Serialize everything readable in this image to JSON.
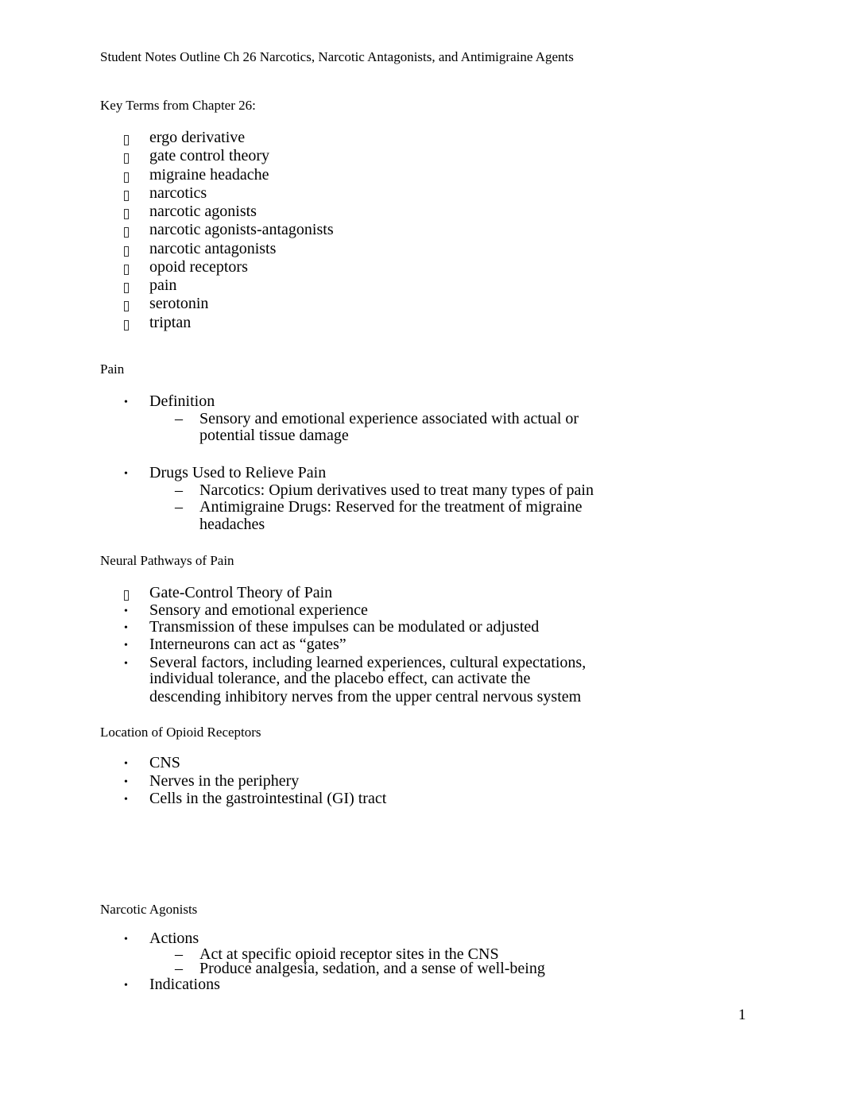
{
  "document": {
    "title": "Student Notes Outline Ch 26 Narcotics, Narcotic Antagonists, and Antimigraine Agents",
    "page_number": "1",
    "key_terms": {
      "heading": "Key Terms from Chapter 26:",
      "bullet_icon": "missing-glyph-box",
      "items": [
        "ergo derivative",
        "gate control theory",
        "migraine headache",
        "narcotics",
        "narcotic agonists",
        "narcotic agonists-antagonists",
        "narcotic antagonists",
        "opoid receptors",
        "pain",
        "serotonin",
        "triptan"
      ]
    },
    "pain": {
      "heading": "Pain",
      "definition": {
        "label": "Definition",
        "sub": [
          "Sensory and emotional experience associated with actual or",
          "potential tissue damage"
        ]
      },
      "drugs": {
        "label": "Drugs Used to Relieve Pain",
        "sub1": "Narcotics: Opium derivatives used to treat many types of pain",
        "sub2": [
          "Antimigraine Drugs: Reserved for the treatment of migraine",
          "headaches"
        ]
      }
    },
    "neural": {
      "heading": "Neural Pathways of Pain",
      "items": [
        "Gate-Control Theory of Pain",
        "Sensory and emotional experience",
        "Transmission of these impulses can be modulated or adjusted",
        "Interneurons can act as “gates”"
      ],
      "last": [
        "Several factors, including learned experiences, cultural expectations,",
        "individual tolerance, and the placebo effect, can activate the",
        "descending inhibitory nerves from the upper central nervous system"
      ]
    },
    "opioid": {
      "heading": "Location of Opioid Receptors",
      "items": [
        "CNS",
        "Nerves in the periphery",
        "Cells in the gastrointestinal (GI) tract"
      ]
    },
    "agonists": {
      "heading": "Narcotic Agonists",
      "actions": "Actions",
      "action_items": [
        "Act at specific opioid receptor sites in the CNS",
        "Produce analgesia, sedation, and a sense of well-being"
      ],
      "indications": "Indications"
    },
    "markers": {
      "bullet": "•",
      "dash": "–"
    }
  }
}
